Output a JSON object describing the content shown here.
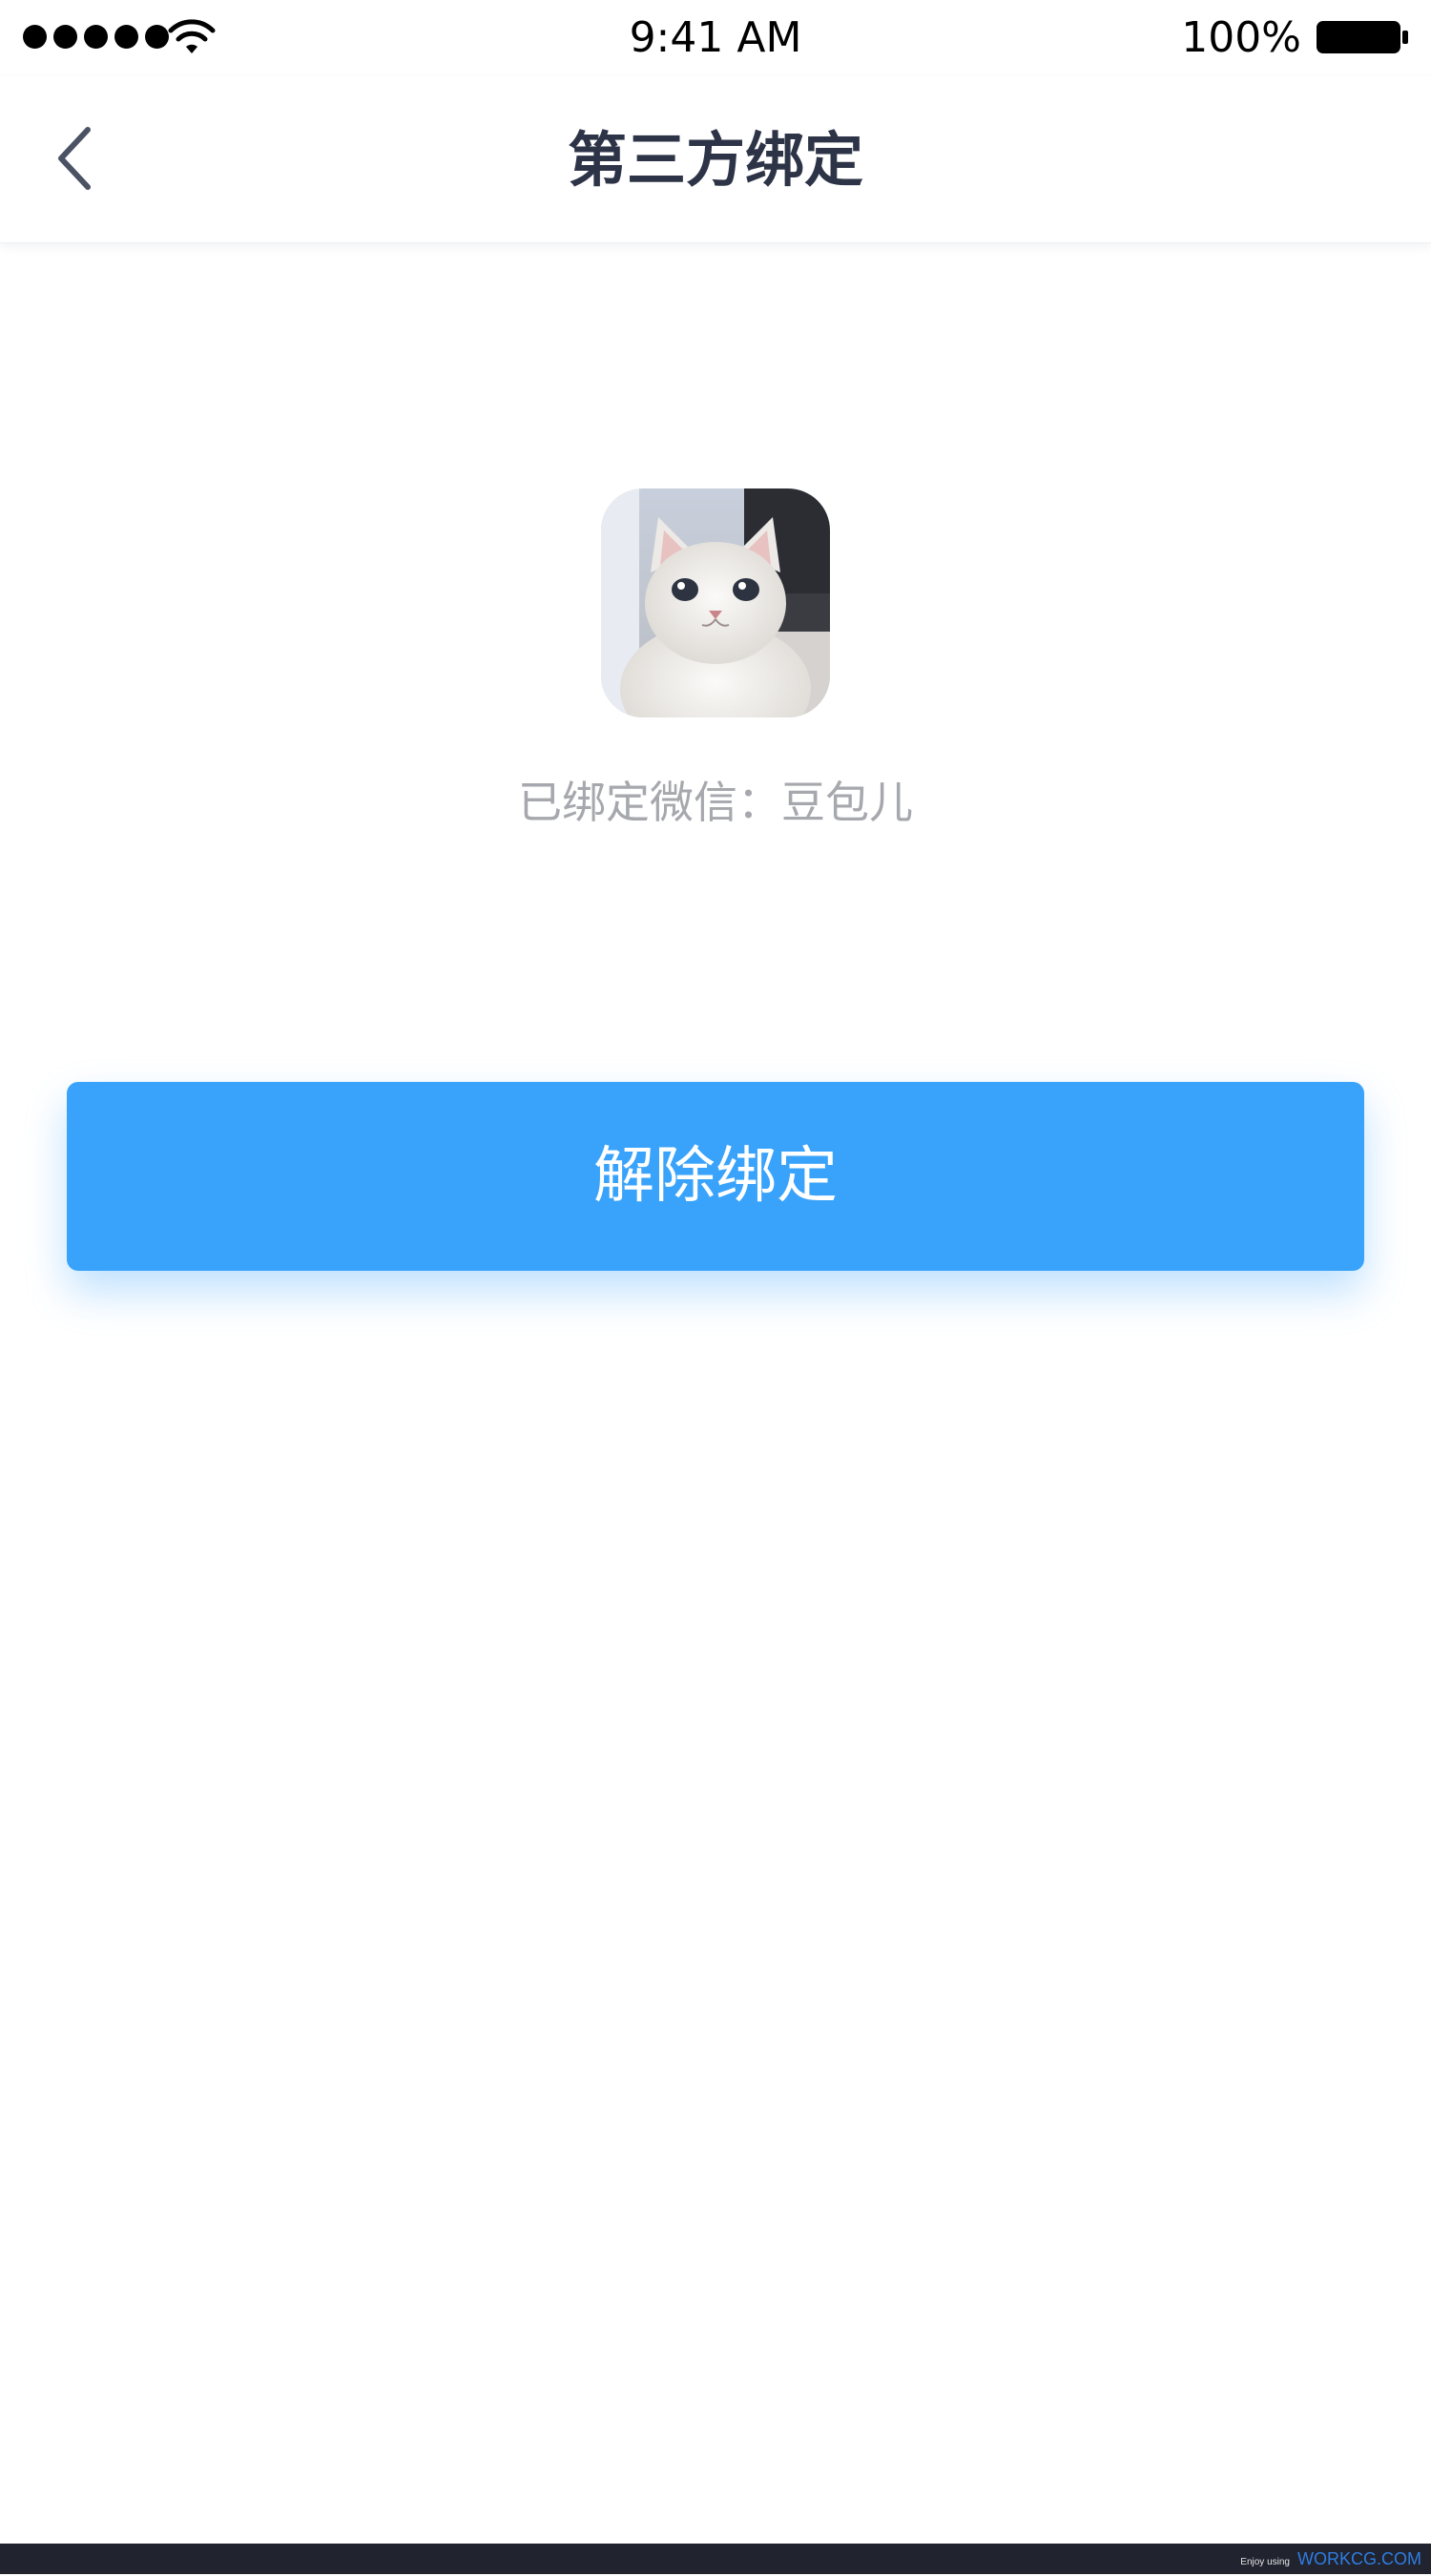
{
  "status_bar": {
    "time": "9:41 AM",
    "battery_percent": "100%",
    "signal_icon": "cellular-signal-dots-icon",
    "wifi_icon": "wifi-icon",
    "battery_icon": "battery-full-icon"
  },
  "nav": {
    "title": "第三方绑定",
    "back_icon": "chevron-left-icon"
  },
  "content": {
    "avatar_icon": "cat-photo-avatar",
    "bound_text": "已绑定微信：豆包儿",
    "unbind_label": "解除绑定"
  },
  "footer": {
    "prefix": "Enjoy using",
    "brand": "WORKCG.COM"
  },
  "colors": {
    "primary": "#39a3fb",
    "title": "#2e3447",
    "muted_text": "#a6a8ad",
    "footer_bg": "#21232f",
    "footer_brand": "#2f7de1"
  }
}
